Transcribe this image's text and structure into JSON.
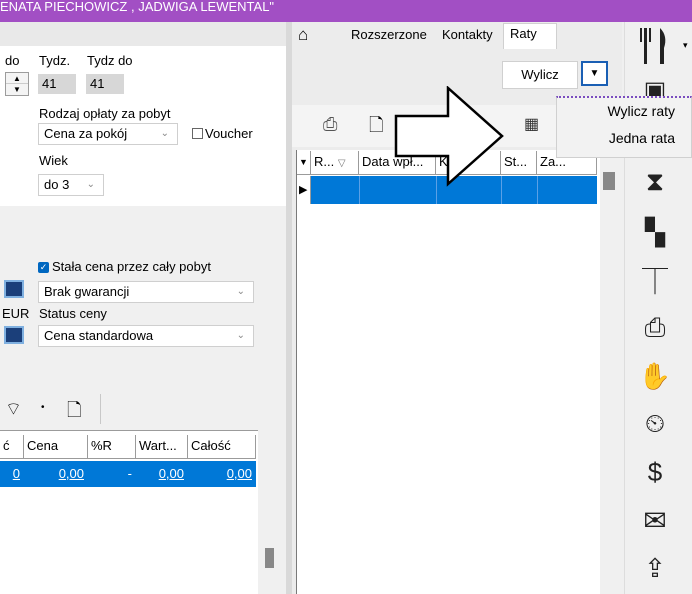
{
  "title_text": "ENATA PIECHOWICZ , JADWIGA LEWENTAL\"",
  "left": {
    "col_do_label": "do",
    "tydz_label": "Tydz.",
    "tydz_do_label": "Tydz do",
    "tydz_value": "41",
    "tydz_do_value": "41",
    "fee_type_label": "Rodzaj opłaty za pobyt",
    "fee_type_value": "Cena za pokój",
    "voucher_label": "Voucher",
    "age_label": "Wiek",
    "age_value": "do 3",
    "fixed_price_label": "Stała cena przez cały pobyt",
    "guarantee_value": "Brak gwarancji",
    "currency_label": "EUR",
    "price_status_label": "Status ceny",
    "price_status_value": "Cena standardowa"
  },
  "bottom_grid": {
    "headers": [
      "ć",
      "Cena",
      "%R",
      "Wart...",
      "Całość"
    ],
    "row": [
      "0",
      "0,00",
      "-",
      "0,00",
      "0,00"
    ]
  },
  "tabs": [
    "Rozszerzone",
    "Kontakty",
    "Raty"
  ],
  "right": {
    "calc_button_label": "Wylicz",
    "grid_headers": [
      "R...",
      "Data wpł...",
      "K...",
      "St...",
      "Za..."
    ]
  },
  "dropdown_menu": {
    "items": [
      "Wylicz raty",
      "Jedna rata"
    ]
  },
  "colors": {
    "titlebar": "#a24fc4",
    "selection": "#0078d7",
    "accent_checkbox": "#0067c0"
  }
}
